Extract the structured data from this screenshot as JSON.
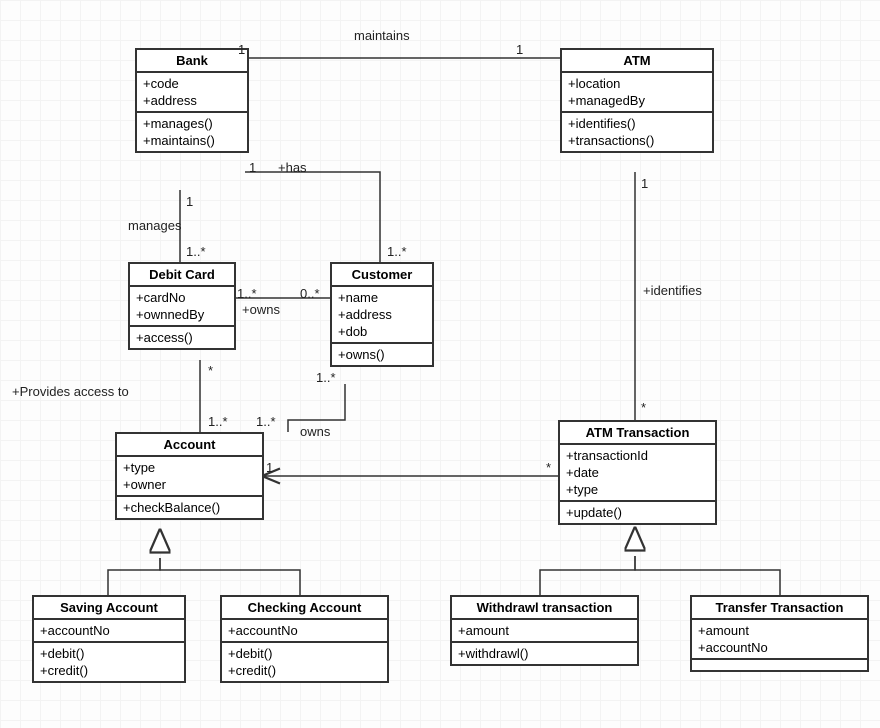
{
  "classes": {
    "bank": {
      "title": "Bank",
      "attrs": [
        "+code",
        "+address"
      ],
      "ops": [
        "+manages()",
        "+maintains()"
      ]
    },
    "atm": {
      "title": "ATM",
      "attrs": [
        "+location",
        "+managedBy"
      ],
      "ops": [
        "+identifies()",
        "+transactions()"
      ]
    },
    "debit": {
      "title": "Debit Card",
      "attrs": [
        "+cardNo",
        "+ownnedBy"
      ],
      "ops": [
        "+access()"
      ]
    },
    "customer": {
      "title": "Customer",
      "attrs": [
        "+name",
        "+address",
        "+dob"
      ],
      "ops": [
        "+owns()"
      ]
    },
    "account": {
      "title": "Account",
      "attrs": [
        "+type",
        "+owner"
      ],
      "ops": [
        "+checkBalance()"
      ]
    },
    "atmtx": {
      "title": "ATM Transaction",
      "attrs": [
        "+transactionId",
        "+date",
        "+type"
      ],
      "ops": [
        "+update()"
      ]
    },
    "saving": {
      "title": "Saving Account",
      "attrs": [
        "+accountNo"
      ],
      "ops": [
        "+debit()",
        "+credit()"
      ]
    },
    "checking": {
      "title": "Checking Account",
      "attrs": [
        "+accountNo"
      ],
      "ops": [
        "+debit()",
        "+credit()"
      ]
    },
    "withdraw": {
      "title": "Withdrawl transaction",
      "attrs": [
        "+amount"
      ],
      "ops": [
        "+withdrawl()"
      ]
    },
    "transfer": {
      "title": "Transfer Transaction",
      "attrs": [
        "+amount",
        "+accountNo"
      ],
      "ops": []
    }
  },
  "labels": {
    "maintains": "maintains",
    "m1a": "1",
    "m1b": "1",
    "has": "+has",
    "has1": "1",
    "has1n": "1..*",
    "manages": "manages",
    "mg1": "1",
    "mg1n": "1..*",
    "owns": "+owns",
    "owns1n": "1..*",
    "owns0n": "0..*",
    "provides": "+Provides access to",
    "provStar": "*",
    "prov1n": "1..*",
    "custowns": "owns",
    "custowns1n": "1..*",
    "custowns1nb": "1..*",
    "identifies": "+identifies",
    "id1": "1",
    "idn": "*",
    "txacc1": "1",
    "txaccn": "*"
  },
  "chart_data": {
    "type": "uml_class_diagram",
    "classes": [
      {
        "name": "Bank",
        "attributes": [
          "+code",
          "+address"
        ],
        "operations": [
          "+manages()",
          "+maintains()"
        ]
      },
      {
        "name": "ATM",
        "attributes": [
          "+location",
          "+managedBy"
        ],
        "operations": [
          "+identifies()",
          "+transactions()"
        ]
      },
      {
        "name": "Debit Card",
        "attributes": [
          "+cardNo",
          "+ownnedBy"
        ],
        "operations": [
          "+access()"
        ]
      },
      {
        "name": "Customer",
        "attributes": [
          "+name",
          "+address",
          "+dob"
        ],
        "operations": [
          "+owns()"
        ]
      },
      {
        "name": "Account",
        "attributes": [
          "+type",
          "+owner"
        ],
        "operations": [
          "+checkBalance()"
        ]
      },
      {
        "name": "ATM Transaction",
        "attributes": [
          "+transactionId",
          "+date",
          "+type"
        ],
        "operations": [
          "+update()"
        ]
      },
      {
        "name": "Saving Account",
        "attributes": [
          "+accountNo"
        ],
        "operations": [
          "+debit()",
          "+credit()"
        ]
      },
      {
        "name": "Checking Account",
        "attributes": [
          "+accountNo"
        ],
        "operations": [
          "+debit()",
          "+credit()"
        ]
      },
      {
        "name": "Withdrawl transaction",
        "attributes": [
          "+amount"
        ],
        "operations": [
          "+withdrawl()"
        ]
      },
      {
        "name": "Transfer Transaction",
        "attributes": [
          "+amount",
          "+accountNo"
        ],
        "operations": []
      }
    ],
    "associations": [
      {
        "from": "Bank",
        "to": "ATM",
        "name": "maintains",
        "mult": {
          "from": "1",
          "to": "1"
        }
      },
      {
        "from": "Bank",
        "to": "Debit Card",
        "name": "manages",
        "mult": {
          "from": "1",
          "to": "1..*"
        }
      },
      {
        "from": "Bank",
        "to": "Customer",
        "name": "+has",
        "mult": {
          "from": "1",
          "to": "1..*"
        }
      },
      {
        "from": "Debit Card",
        "to": "Customer",
        "name": "+owns",
        "mult": {
          "from": "1..*",
          "to": "0..*"
        }
      },
      {
        "from": "Debit Card",
        "to": "Account",
        "name": "+Provides access to",
        "mult": {
          "from": "*",
          "to": "1..*"
        }
      },
      {
        "from": "Customer",
        "to": "Account",
        "name": "owns",
        "mult": {
          "from": "1..*",
          "to": "1..*"
        }
      },
      {
        "from": "ATM",
        "to": "ATM Transaction",
        "name": "+identifies",
        "mult": {
          "from": "1",
          "to": "*"
        }
      },
      {
        "from": "ATM Transaction",
        "to": "Account",
        "navigable": "to",
        "mult": {
          "from": "*",
          "to": "1"
        }
      }
    ],
    "generalizations": [
      {
        "parent": "Account",
        "children": [
          "Saving Account",
          "Checking Account"
        ]
      },
      {
        "parent": "ATM Transaction",
        "children": [
          "Withdrawl transaction",
          "Transfer Transaction"
        ]
      }
    ]
  }
}
